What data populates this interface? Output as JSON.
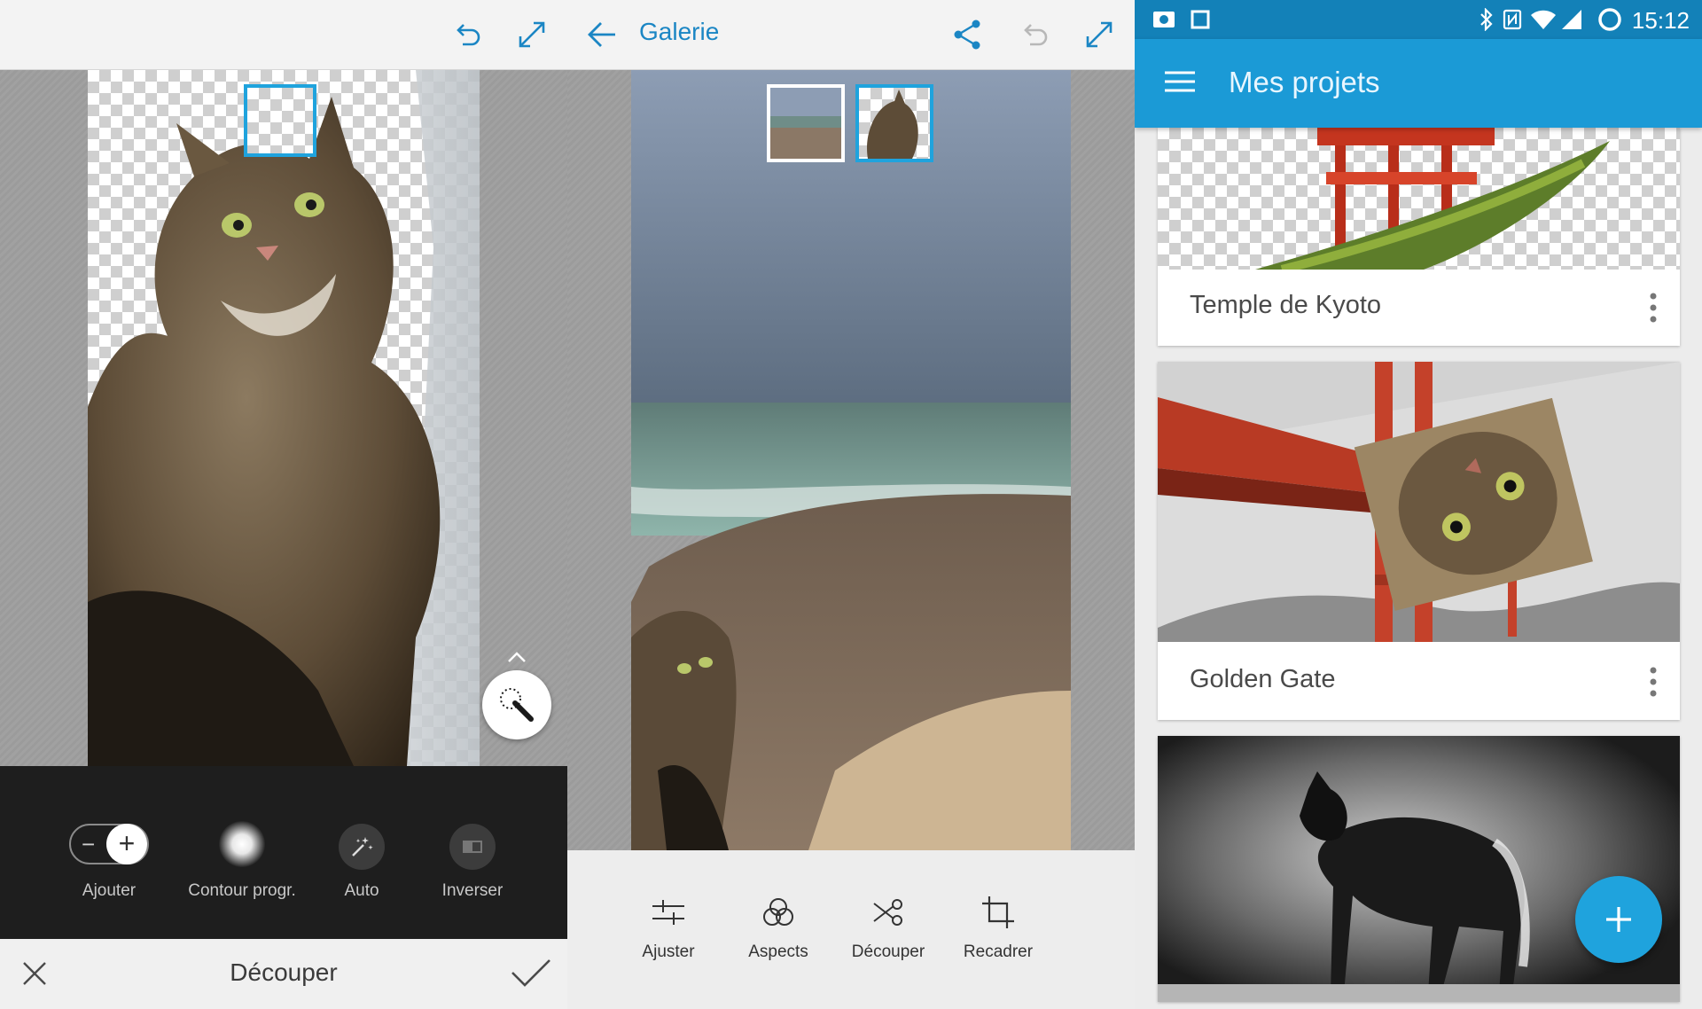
{
  "left_panel": {
    "tools": [
      {
        "label": "Ajouter"
      },
      {
        "label": "Contour progr."
      },
      {
        "label": "Auto"
      },
      {
        "label": "Inverser"
      }
    ],
    "toggle_minus": "−",
    "toggle_plus": "+",
    "bottom_title": "Découper"
  },
  "middle_panel": {
    "title": "Galerie",
    "tools": [
      {
        "label": "Ajuster"
      },
      {
        "label": "Aspects"
      },
      {
        "label": "Découper"
      },
      {
        "label": "Recadrer"
      }
    ]
  },
  "right_panel": {
    "status_time": "15:12",
    "title": "Mes projets",
    "projects": [
      {
        "name": "Temple de Kyoto"
      },
      {
        "name": "Golden Gate"
      }
    ]
  },
  "colors": {
    "accent": "#1fa3dd",
    "app_bar": "#1b9ad6",
    "status_bar": "#1381b8",
    "dark_toolbar": "#1e1e1e"
  }
}
